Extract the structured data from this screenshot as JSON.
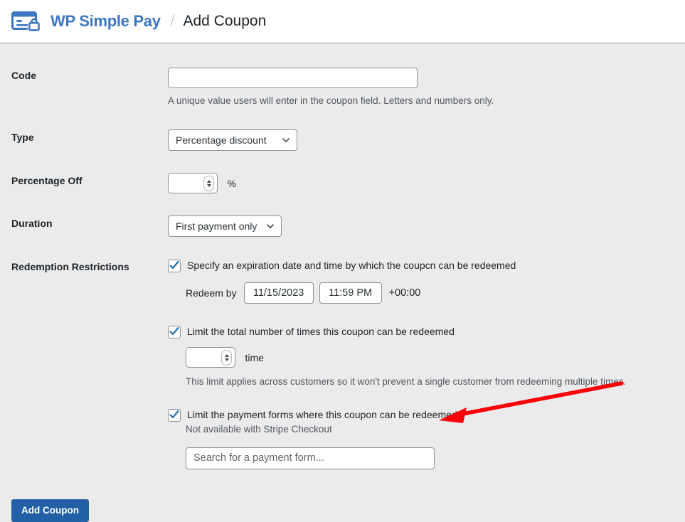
{
  "header": {
    "logo_icon": "credit-card-lock-icon",
    "brand": "WP Simple Pay",
    "separator": "/",
    "title": "Add Coupon",
    "brand_color": "#3d77c2"
  },
  "form": {
    "code": {
      "label": "Code",
      "value": "",
      "placeholder": "",
      "help": "A unique value users will enter in the coupon field. Letters and numbers only."
    },
    "type": {
      "label": "Type",
      "selected": "Percentage discount",
      "chevron_icon": "chevron-down-icon"
    },
    "percentage_off": {
      "label": "Percentage Off",
      "value": "",
      "unit": "%",
      "spinner_icon": "number-spinner-icon"
    },
    "duration": {
      "label": "Duration",
      "selected": "First payment only",
      "chevron_icon": "chevron-down-icon"
    },
    "redemption": {
      "label": "Redemption Restrictions",
      "expiration": {
        "checked": true,
        "check_icon": "checkmark-icon",
        "label": "Specify an expiration date and time by which the coupcn can be redeemed",
        "redeem_by_label": "Redeem by",
        "date_value": "11/15/2023",
        "time_value": "11:59 PM",
        "timezone": "+00:00"
      },
      "limit_total": {
        "checked": true,
        "check_icon": "checkmark-icon",
        "label": "Limit the total number of times this coupon can be redeemed",
        "value": "",
        "unit": "time",
        "spinner_icon": "number-spinner-icon",
        "help": "This limit applies across customers so it won't prevent a single customer from redeeming multiple times."
      },
      "limit_forms": {
        "checked": true,
        "check_icon": "checkmark-icon",
        "label": "Limit the payment forms where this coupon can be redeemed",
        "note": "Not available with Stripe Checkout",
        "search_value": "",
        "search_placeholder": "Search for a payment form..."
      }
    }
  },
  "submit": {
    "label": "Add Coupon",
    "color": "#2160a5"
  },
  "annotation": {
    "arrow_icon": "red-arrow-pointing-left-icon",
    "color": "#fb0007"
  }
}
